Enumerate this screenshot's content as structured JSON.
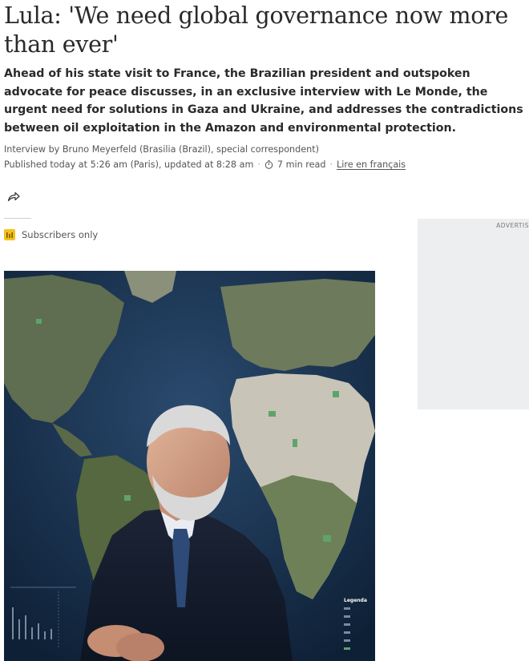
{
  "article": {
    "headline": "Lula: 'We need global governance now more than ever'",
    "standfirst": "Ahead of his state visit to France, the Brazilian president and outspoken advocate for peace discusses, in an exclusive interview with Le Monde, the urgent need for solutions in Gaza and Ukraine, and addresses the contradictions between oil exploitation in the Amazon and environmental protection.",
    "byline": "Interview by Bruno Meyerfeld (Brasilia (Brazil), special correspondent)",
    "published": "Published today at 5:26 am (Paris), updated at 8:28 am",
    "separator": "·",
    "read_time": "7 min read",
    "french_link": "Lire en français",
    "access_label": "Subscribers only",
    "access_icon": "subscriber-badge-icon",
    "share_icon": "share-arrow-icon"
  },
  "advert": {
    "label": "ADVERTIS"
  },
  "photo": {
    "legend_title": "Legenda",
    "accent_colors": {
      "access_badge": "#f3c11b",
      "map_ocean": "#1b3554",
      "map_land": "#6d7a5c",
      "map_desert": "#c9c4b8"
    }
  }
}
